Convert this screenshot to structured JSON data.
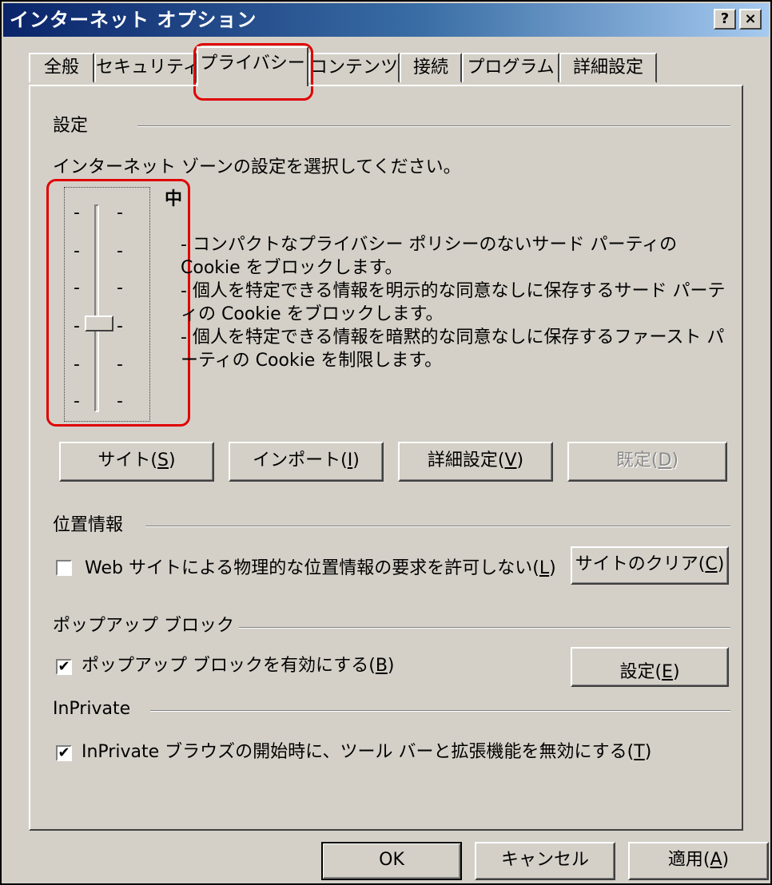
{
  "window": {
    "title": "インターネット オプション",
    "help_glyph": "?",
    "close_glyph": "×"
  },
  "tabs": [
    {
      "label": "全般"
    },
    {
      "label": "セキュリティ"
    },
    {
      "label": "プライバシー",
      "active": true
    },
    {
      "label": "コンテンツ"
    },
    {
      "label": "接続"
    },
    {
      "label": "プログラム"
    },
    {
      "label": "詳細設定"
    }
  ],
  "settings": {
    "section_label": "設定",
    "prompt": "インターネット ゾーンの設定を選択してください。",
    "level_label": "中",
    "tick_mark": "-",
    "description": [
      "- コンパクトなプライバシー ポリシーのないサード パーティの Cookie をブロックします。",
      "- 個人を特定できる情報を明示的な同意なしに保存するサード パーティの Cookie をブロックします。",
      "- 個人を特定できる情報を暗黙的な同意なしに保存するファースト パーティの Cookie を制限します。"
    ],
    "slider_level": 2,
    "buttons": {
      "sites": {
        "text": "サイト(",
        "key": "S",
        "end": ")"
      },
      "import": {
        "text": "インポート(",
        "key": "I",
        "end": ")"
      },
      "advanced": {
        "text": "詳細設定(",
        "key": "V",
        "end": ")"
      },
      "default": {
        "text": "既定(",
        "key": "D",
        "end": ")"
      }
    }
  },
  "location": {
    "section_label": "位置情報",
    "checkbox_label_text": "Web サイトによる物理的な位置情報の要求を許可しない(",
    "checkbox_label_key": "L",
    "checkbox_label_end": ")",
    "checked": false,
    "clear_button": {
      "text": "サイトのクリア(",
      "key": "C",
      "end": ")"
    }
  },
  "popup": {
    "section_label": "ポップアップ ブロック",
    "checkbox_label_text": "ポップアップ ブロックを有効にする(",
    "checkbox_label_key": "B",
    "checkbox_label_end": ")",
    "checked": true,
    "settings_button": {
      "text": "設定(",
      "key": "E",
      "end": ")"
    }
  },
  "inprivate": {
    "section_label": "InPrivate",
    "checkbox_label_text": "InPrivate ブラウズの開始時に、ツール バーと拡張機能を無効にする(",
    "checkbox_label_key": "T",
    "checkbox_label_end": ")",
    "checked": true
  },
  "footer": {
    "ok": "OK",
    "cancel": "キャンセル",
    "apply": {
      "text": "適用(",
      "key": "A",
      "end": ")"
    }
  },
  "check_glyph": "✔",
  "colors": {
    "highlight": "#e00000",
    "title_bar": "#0a246a",
    "face": "#d4d0c8"
  }
}
